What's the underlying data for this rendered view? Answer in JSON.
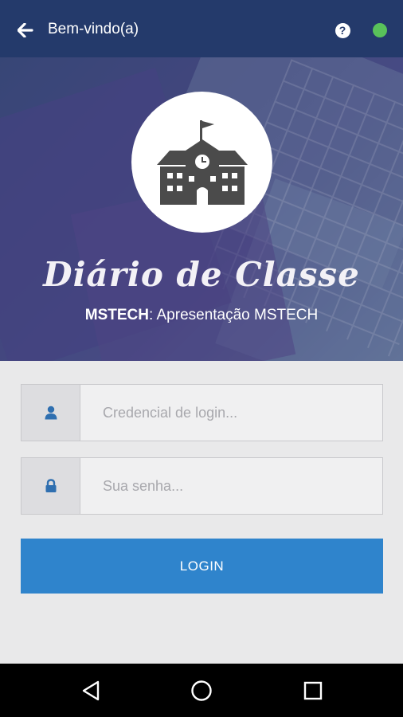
{
  "appbar": {
    "title": "Bem-vindo(a)",
    "back_icon": "arrow-left-icon",
    "help_icon": "question-icon",
    "help_glyph": "?",
    "status_color": "#59c25a"
  },
  "hero": {
    "logo_icon": "school-building-icon",
    "app_name": "Diário de Classe",
    "org_code": "MSTECH",
    "org_separator": ":",
    "org_name": "Apresentação MSTECH"
  },
  "login": {
    "credential_placeholder": "Credencial de login...",
    "credential_value": "",
    "password_placeholder": "Sua senha...",
    "password_value": "",
    "user_icon": "user-icon",
    "lock_icon": "lock-icon",
    "submit_label": "LOGIN"
  },
  "navbar": {
    "back_icon": "triangle-back-icon",
    "home_icon": "circle-home-icon",
    "recents_icon": "square-recents-icon"
  },
  "colors": {
    "appbar": "#243a6b",
    "accent": "#2f84cc",
    "field_icon": "#2f6fb0"
  }
}
